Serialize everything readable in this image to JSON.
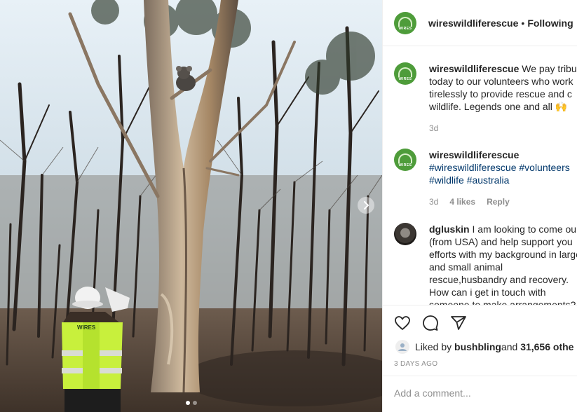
{
  "post": {
    "photo_description_icon": "burnt-forest-koala-photo",
    "next_icon": "chevron-right-icon"
  },
  "header": {
    "username": "wireswildliferescue",
    "separator": "•",
    "follow_status": "Following",
    "avatar_text": "WIRES"
  },
  "comments": [
    {
      "username": "wireswildliferescue",
      "text": " We pay tribu today to our volunteers who work tirelessly to provide rescue and c wildlife. Legends one and all 🙌",
      "age": "3d"
    },
    {
      "username": "wireswildliferescue",
      "hashtags": "#wireswildliferescue #volunteers #wildlife #australia",
      "age": "3d",
      "likes": "4 likes",
      "reply": "Reply"
    },
    {
      "username": "dgluskin",
      "text": " I am looking to come ou (from USA) and help support you efforts with my background in large and small animal rescue,husbandry and recovery. How can i get in touch with someone to make arrangements?"
    }
  ],
  "actions": {
    "like_icon": "heart-icon",
    "comment_icon": "comment-icon",
    "share_icon": "share-icon"
  },
  "likes": {
    "prefix": "Liked by ",
    "user": "bushbling",
    "middle": " and ",
    "count": "31,656 othe"
  },
  "timestamp": "3 DAYS AGO",
  "add_comment": {
    "placeholder": "Add a comment..."
  },
  "colors": {
    "wires_green": "#4e9c3a",
    "hashtag_blue": "#00376b",
    "vest_yellow": "#c8f03c"
  }
}
